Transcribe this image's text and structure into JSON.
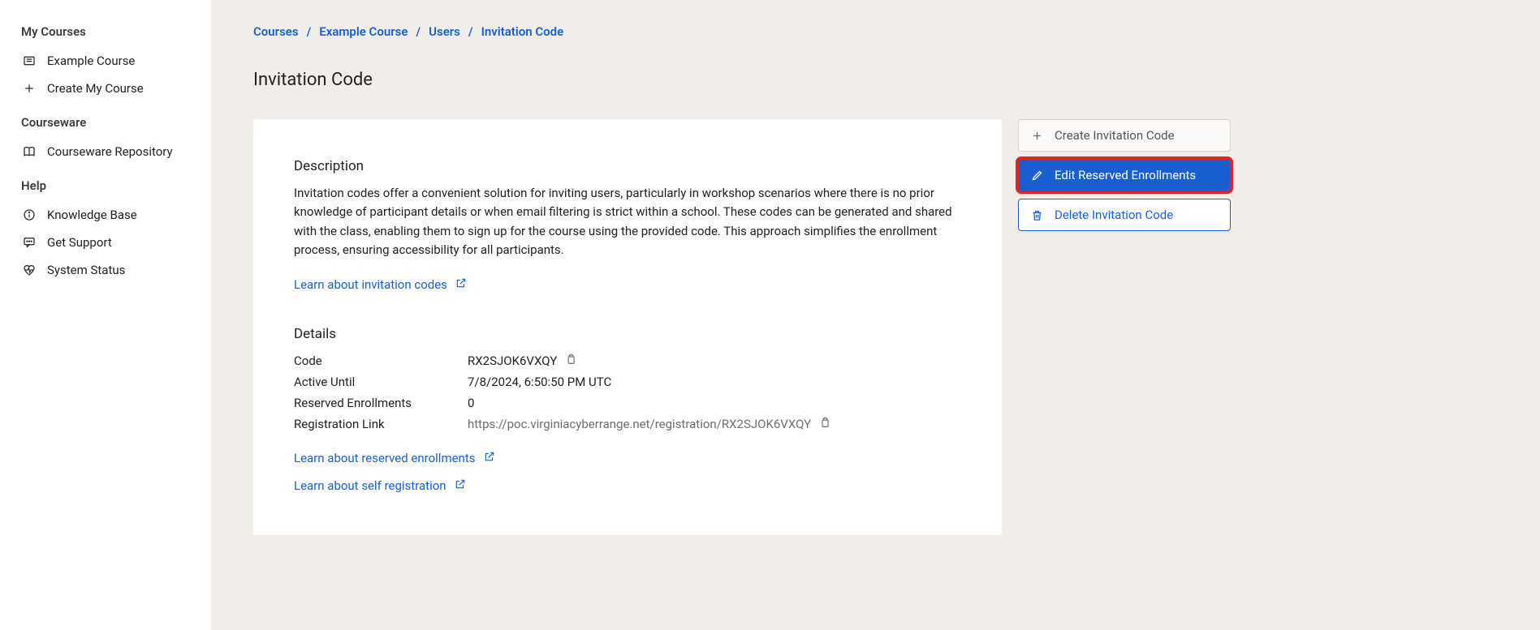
{
  "sidebar": {
    "sections": [
      {
        "title": "My Courses",
        "items": [
          {
            "label": "Example Course",
            "icon": "course-icon"
          },
          {
            "label": "Create My Course",
            "icon": "plus-icon"
          }
        ]
      },
      {
        "title": "Courseware",
        "items": [
          {
            "label": "Courseware Repository",
            "icon": "book-icon"
          }
        ]
      },
      {
        "title": "Help",
        "items": [
          {
            "label": "Knowledge Base",
            "icon": "info-icon"
          },
          {
            "label": "Get Support",
            "icon": "chat-icon"
          },
          {
            "label": "System Status",
            "icon": "heartbeat-icon"
          }
        ]
      }
    ]
  },
  "breadcrumb": {
    "items": [
      "Courses",
      "Example Course",
      "Users",
      "Invitation Code"
    ]
  },
  "page": {
    "title": "Invitation Code"
  },
  "card": {
    "description_heading": "Description",
    "description_text": "Invitation codes offer a convenient solution for inviting users, particularly in workshop scenarios where there is no prior knowledge of participant details or when email filtering is strict within a school. These codes can be generated and shared with the class, enabling them to sign up for the course using the provided code. This approach simplifies the enrollment process, ensuring accessibility for all participants.",
    "learn_invitation_link": "Learn about invitation codes",
    "details_heading": "Details",
    "details": {
      "code_label": "Code",
      "code_value": "RX2SJOK6VXQY",
      "active_until_label": "Active Until",
      "active_until_value": "7/8/2024, 6:50:50 PM UTC",
      "reserved_label": "Reserved Enrollments",
      "reserved_value": "0",
      "registration_link_label": "Registration Link",
      "registration_link_value": "https://poc.virginiacyberrange.net/registration/RX2SJOK6VXQY"
    },
    "learn_reserved_link": "Learn about reserved enrollments",
    "learn_self_reg_link": "Learn about self registration"
  },
  "actions": {
    "create_label": "Create Invitation Code",
    "edit_label": "Edit Reserved Enrollments",
    "delete_label": "Delete Invitation Code"
  }
}
